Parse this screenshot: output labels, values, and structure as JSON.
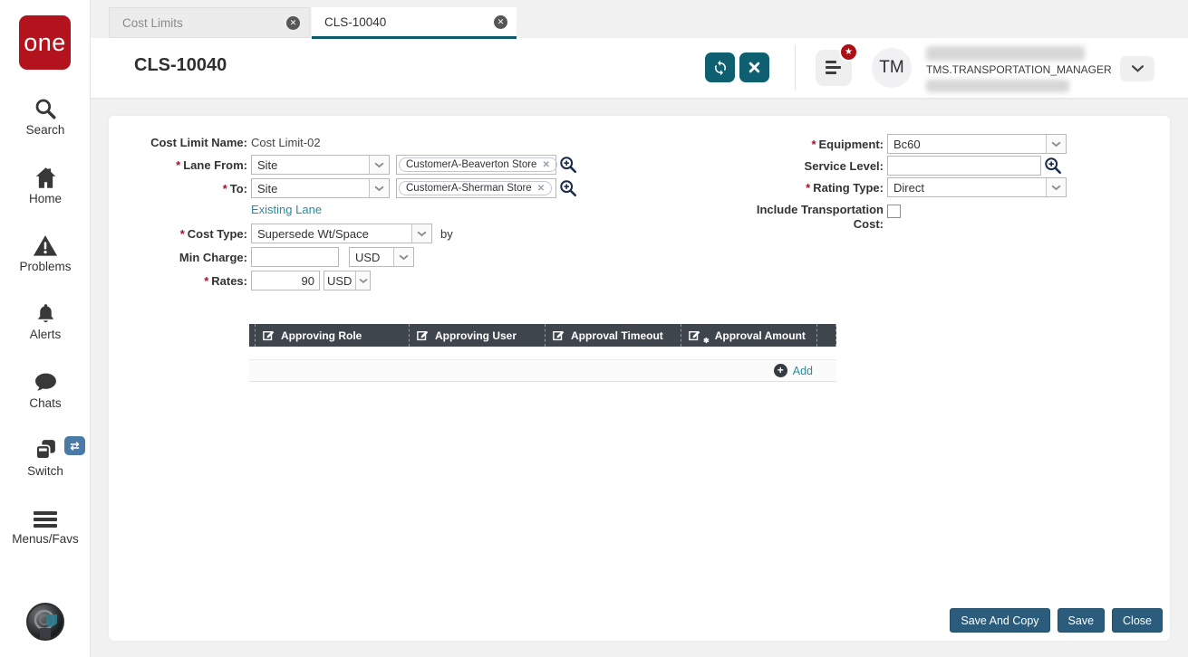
{
  "colors": {
    "logo_red": "#b3131d",
    "accent_teal": "#0e5f70",
    "link_teal": "#2a8a9d",
    "table_header_bg": "#3e454d",
    "footer_button_blue": "#2c5c7c",
    "notification_badge_red": "#ab1016",
    "switch_badge_blue": "#4a7aa6"
  },
  "sidebar": {
    "logo_text": "one",
    "items": [
      {
        "label": "Search",
        "icon": "search-icon"
      },
      {
        "label": "Home",
        "icon": "home-icon"
      },
      {
        "label": "Problems",
        "icon": "problems-icon"
      },
      {
        "label": "Alerts",
        "icon": "alerts-icon"
      },
      {
        "label": "Chats",
        "icon": "chats-icon"
      },
      {
        "label": "Switch",
        "icon": "switch-icon"
      },
      {
        "label": "Menus/Favs",
        "icon": "menus-icon"
      }
    ]
  },
  "tabs": [
    {
      "label": "Cost Limits",
      "active": false
    },
    {
      "label": "CLS-10040",
      "active": true
    }
  ],
  "header": {
    "title": "CLS-10040",
    "user": {
      "initials": "TM",
      "role": "TMS.TRANSPORTATION_MANAGER"
    }
  },
  "form": {
    "required_marker": "*",
    "cost_limit_name": {
      "label": "Cost Limit Name:",
      "value": "Cost Limit-02"
    },
    "lane_from": {
      "label": "Lane From:",
      "selected": "Site",
      "chip": "CustomerA-Beaverton Store"
    },
    "to": {
      "label": "To:",
      "selected": "Site",
      "chip": "CustomerA-Sherman Store"
    },
    "existing_lane_link": "Existing Lane",
    "cost_type": {
      "label": "Cost Type:",
      "selected": "Supersede Wt/Space",
      "suffix": "by"
    },
    "min_charge": {
      "label": "Min Charge:",
      "value": "",
      "currency": "USD"
    },
    "rates": {
      "label": "Rates:",
      "value": "90",
      "currency": "USD"
    },
    "equipment": {
      "label": "Equipment:",
      "selected": "Bc60"
    },
    "service_level": {
      "label": "Service Level:",
      "value": ""
    },
    "rating_type": {
      "label": "Rating Type:",
      "selected": "Direct"
    },
    "include_transportation_cost": {
      "label": "Include Transportation Cost:",
      "checked": false
    }
  },
  "approval_table": {
    "columns": [
      {
        "label": "Approving Role"
      },
      {
        "label": "Approving User"
      },
      {
        "label": "Approval Timeout"
      },
      {
        "label": "Approval Amount",
        "required": true
      }
    ],
    "rows": [],
    "add_label": "Add"
  },
  "footer": {
    "buttons": [
      {
        "label": "Save And Copy"
      },
      {
        "label": "Save"
      },
      {
        "label": "Close"
      }
    ]
  }
}
